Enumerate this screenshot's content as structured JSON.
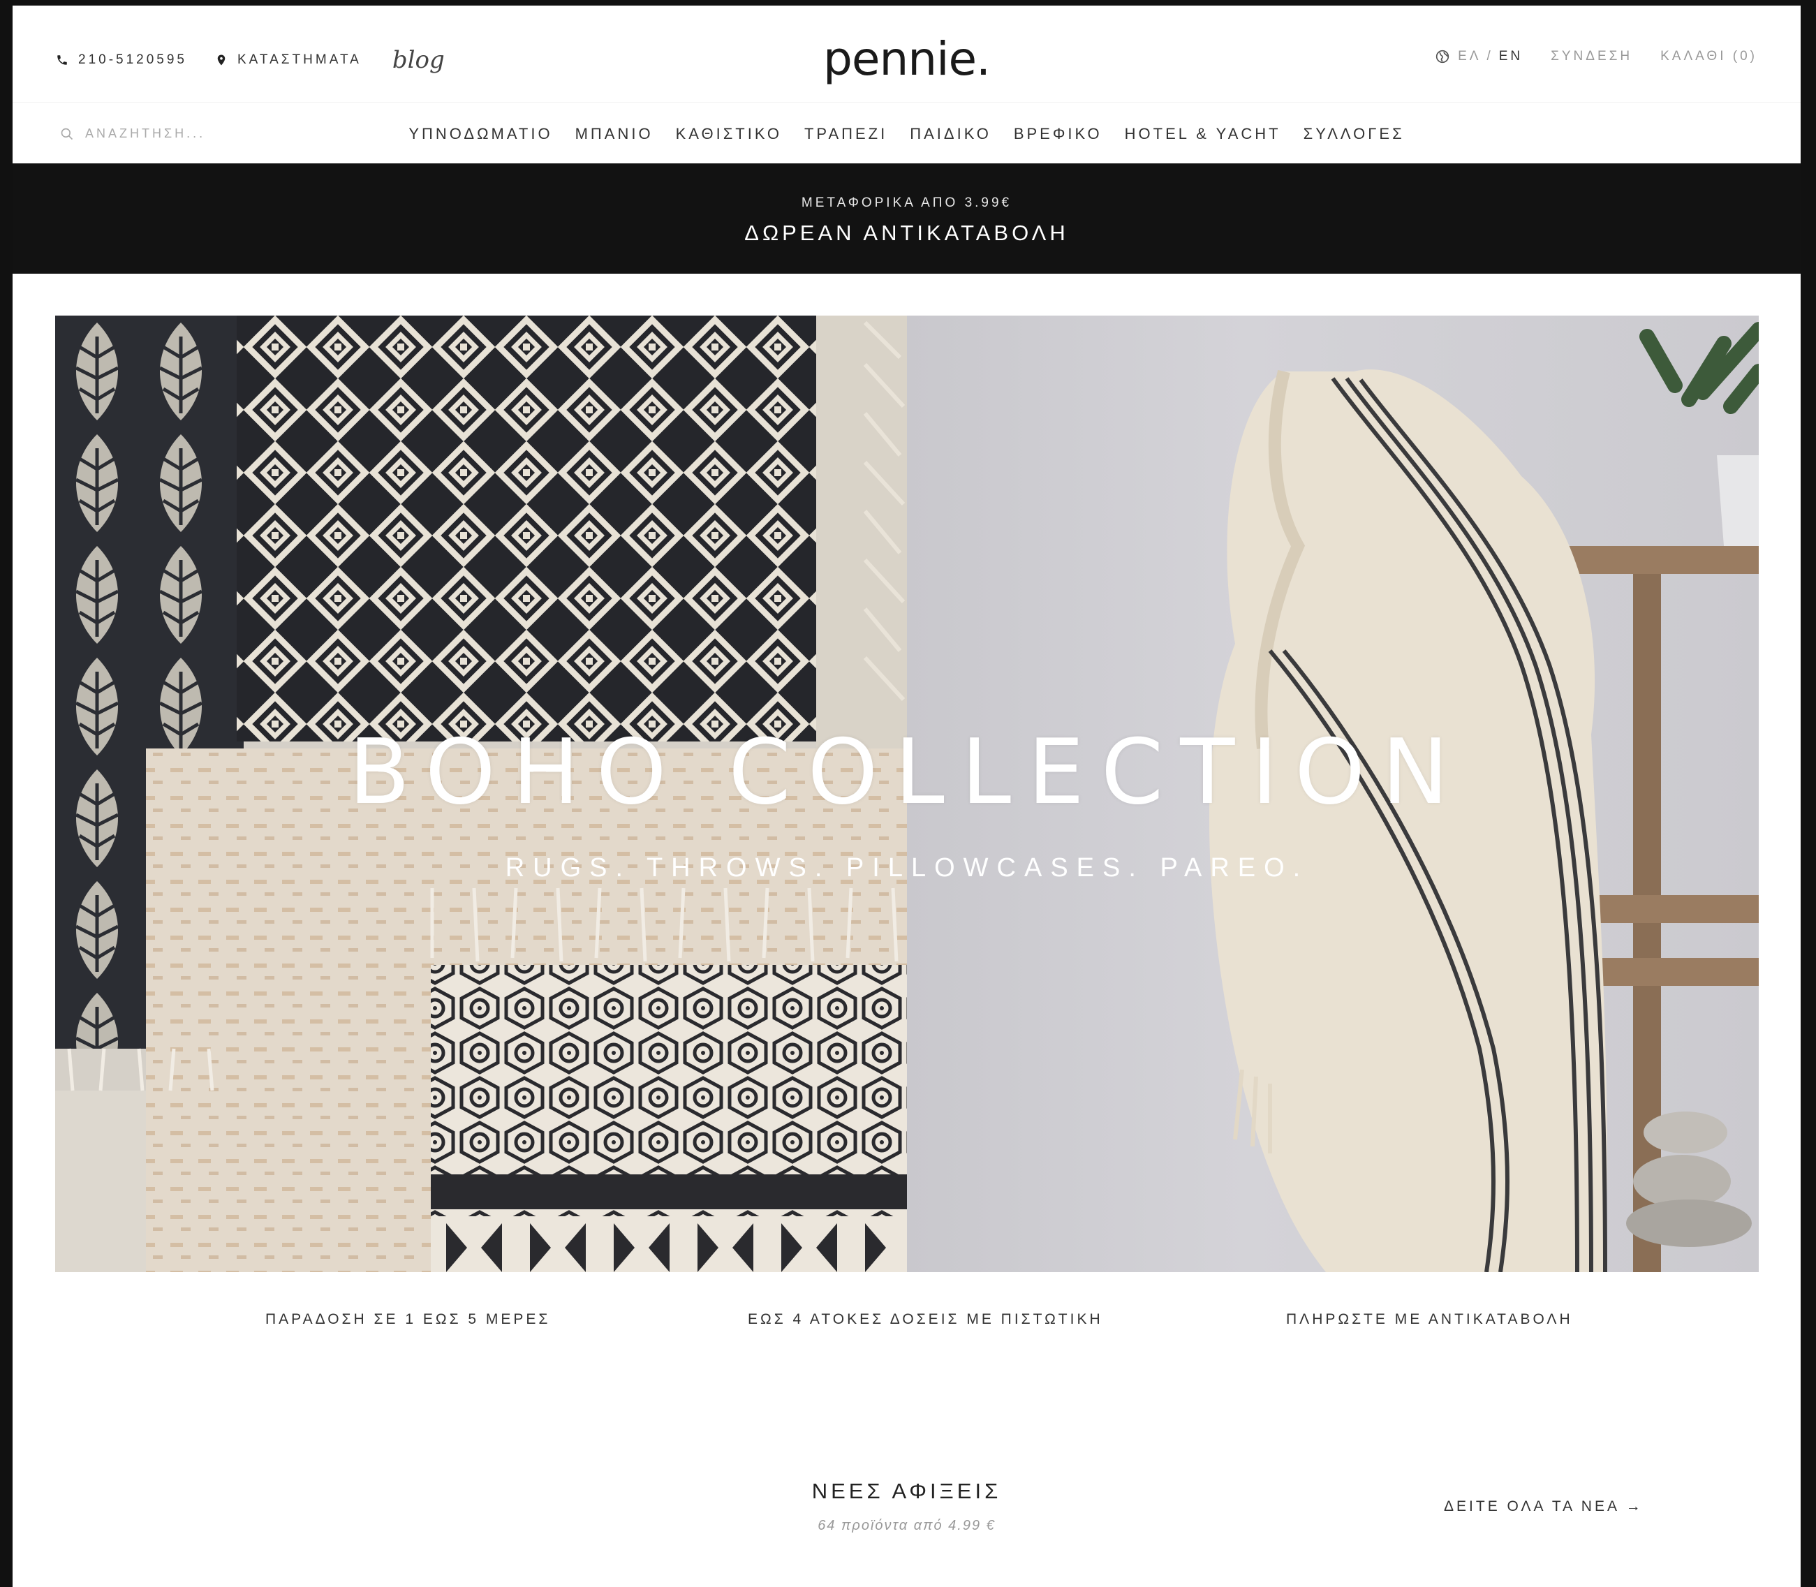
{
  "topbar": {
    "phone": "210-5120595",
    "stores": "ΚΑΤΑΣΤΗΜΑΤΑ",
    "blog": "blog",
    "logo": "pennie.",
    "lang_el": "ΕΛ",
    "lang_sep": "/",
    "lang_en": "EN",
    "login": "ΣΥΝΔΕΣΗ",
    "cart": "ΚΑΛΑΘΙ (0)"
  },
  "search": {
    "placeholder": "ΑΝΑΖΗΤΗΣΗ..."
  },
  "nav": {
    "items": [
      {
        "label": "ΥΠΝΟΔΩΜΑΤΙΟ"
      },
      {
        "label": "ΜΠΑΝΙΟ"
      },
      {
        "label": "ΚΑΘΙΣΤΙΚΟ"
      },
      {
        "label": "ΤΡΑΠΕΖΙ"
      },
      {
        "label": "ΠΑΙΔΙΚΟ"
      },
      {
        "label": "ΒΡΕΦΙΚΟ"
      },
      {
        "label": "HOTEL & YACHT"
      },
      {
        "label": "ΣΥΛΛΟΓΕΣ"
      }
    ]
  },
  "announce": {
    "small": "ΜΕΤΑΦΟΡΙΚΑ ΑΠΟ 3.99€",
    "big": "ΔΩΡΕΑΝ ΑΝΤΙΚΑΤΑΒΟΛΗ"
  },
  "hero": {
    "title": "BOHO COLLECTION",
    "subtitle": "RUGS. THROWS. PILLOWCASES. PAREO."
  },
  "features": [
    {
      "label": "ΠΑΡΑΔΟΣΗ ΣΕ 1 ΕΩΣ 5 ΜΕΡΕΣ"
    },
    {
      "label": "ΕΩΣ 4 ΑΤΟΚΕΣ ΔΟΣΕΙΣ ΜΕ ΠΙΣΤΩΤΙΚΗ"
    },
    {
      "label": "ΠΛΗΡΩΣΤΕ ΜΕ ΑΝΤΙΚΑΤΑΒΟΛΗ"
    }
  ],
  "arrivals": {
    "title": "ΝΕΕΣ ΑΦΙΞΕΙΣ",
    "subtitle": "64 προϊόντα από 4.99 €",
    "link": "ΔΕΙΤΕ ΟΛΑ ΤΑ ΝΕΑ →"
  },
  "colors": {
    "announce_bg": "#121212",
    "page_bg": "#ffffff",
    "frame": "#111111"
  }
}
